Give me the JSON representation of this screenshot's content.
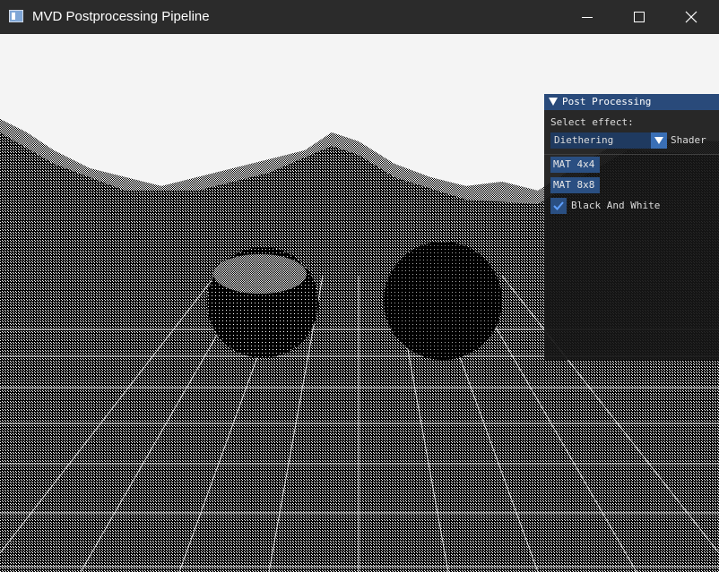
{
  "window": {
    "title": "MVD Postprocessing Pipeline"
  },
  "panel": {
    "title": "Post Processing",
    "select_label": "Select effect:",
    "combo_value": "Diethering",
    "combo_label": "Shader",
    "buttons": [
      {
        "label": "MAT 4x4"
      },
      {
        "label": "MAT 8x8"
      }
    ],
    "checkbox": {
      "label": "Black And White",
      "checked": true
    }
  },
  "colors": {
    "titlebar": "#2b2b2b",
    "panel_header": "#294a7a",
    "button": "#2a4f82",
    "accent": "#3a6fb5"
  }
}
